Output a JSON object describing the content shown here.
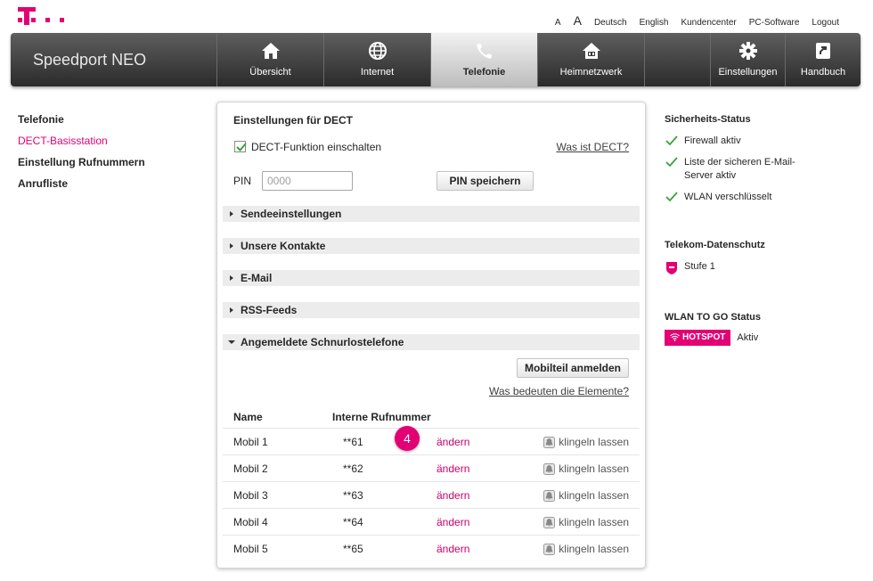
{
  "topnav": {
    "font_small": "A",
    "font_large": "A",
    "links": [
      "Deutsch",
      "English",
      "Kundencenter",
      "PC-Software",
      "Logout"
    ]
  },
  "brand": "Speedport NEO",
  "mainnav": {
    "items": [
      {
        "label": "Übersicht",
        "icon": "home-icon"
      },
      {
        "label": "Internet",
        "icon": "globe-icon"
      },
      {
        "label": "Telefonie",
        "icon": "phone-icon",
        "active": true
      },
      {
        "label": "Heimnetzwerk",
        "icon": "home-network-icon"
      },
      {
        "label": "Einstellungen",
        "icon": "gear-icon"
      },
      {
        "label": "Handbuch",
        "icon": "manual-icon"
      }
    ]
  },
  "sidenav": {
    "items": [
      "Telefonie",
      "DECT-Basisstation",
      "Einstellung Rufnummern",
      "Anrufliste"
    ],
    "active_index": 1
  },
  "dect": {
    "title": "Einstellungen für DECT",
    "checkbox_label": "DECT-Funktion einschalten",
    "checkbox_checked": true,
    "what_is_link": "Was ist DECT?",
    "pin_label": "PIN",
    "pin_placeholder": "0000",
    "pin_button": "PIN speichern",
    "sections": [
      {
        "label": "Sendeeinstellungen",
        "expanded": false
      },
      {
        "label": "Unsere Kontakte",
        "expanded": false
      },
      {
        "label": "E-Mail",
        "expanded": false
      },
      {
        "label": "RSS-Feeds",
        "expanded": false
      },
      {
        "label": "Angemeldete Schnurlostelefone",
        "expanded": true
      }
    ],
    "register_button": "Mobilteil anmelden",
    "elements_link": "Was bedeuten die Elemente?",
    "table": {
      "headers": [
        "Name",
        "Interne Rufnummer"
      ],
      "rows": [
        {
          "name": "Mobil 1",
          "number": "**61",
          "edit": "ändern",
          "ring": "klingeln lassen"
        },
        {
          "name": "Mobil 2",
          "number": "**62",
          "edit": "ändern",
          "ring": "klingeln lassen"
        },
        {
          "name": "Mobil 3",
          "number": "**63",
          "edit": "ändern",
          "ring": "klingeln lassen"
        },
        {
          "name": "Mobil 4",
          "number": "**64",
          "edit": "ändern",
          "ring": "klingeln lassen"
        },
        {
          "name": "Mobil 5",
          "number": "**65",
          "edit": "ändern",
          "ring": "klingeln lassen"
        }
      ]
    },
    "step_badge": "4"
  },
  "right": {
    "security_title": "Sicherheits-Status",
    "security_items": [
      "Firewall aktiv",
      "Liste der sicheren E-Mail-Server aktiv",
      "WLAN verschlüsselt"
    ],
    "privacy_title": "Telekom-Datenschutz",
    "privacy_level": "Stufe 1",
    "wlan_title": "WLAN TO GO Status",
    "hotspot_label": "HOTSPOT",
    "hotspot_status": "Aktiv"
  },
  "colors": {
    "magenta": "#e20074",
    "nav_dark": "#2b2b2b",
    "check_green": "#3aa13a"
  }
}
